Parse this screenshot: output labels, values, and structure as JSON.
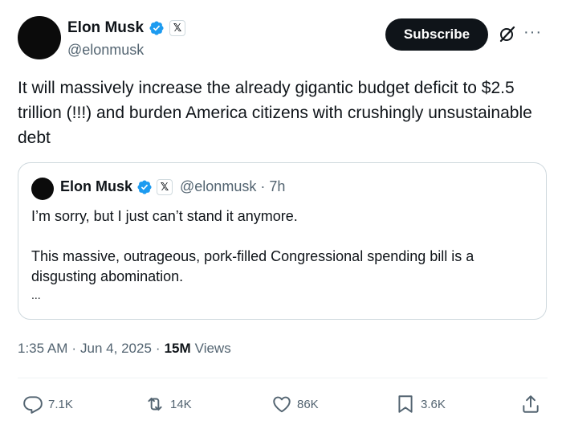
{
  "author": {
    "display_name": "Elon Musk",
    "handle": "@elonmusk",
    "badge_letter": "𝕏"
  },
  "header": {
    "subscribe_label": "Subscribe",
    "more_label": "···"
  },
  "tweet": {
    "text": "It will massively increase the already gigantic budget deficit to $2.5 trillion (!!!) and burden America citizens with crushingly unsustainable debt"
  },
  "quoted": {
    "display_name": "Elon Musk",
    "badge_letter": "𝕏",
    "handle_time": "@elonmusk · 7h",
    "line1": "I’m sorry, but I just can’t stand it anymore.",
    "line2": "This massive, outrageous, pork-filled Congressional spending bill is a disgusting abomination.",
    "ellipsis": "..."
  },
  "meta": {
    "time": "1:35 AM",
    "sep1": "·",
    "date": "Jun 4, 2025",
    "sep2": "·",
    "views_count": "15M",
    "views_label": "Views"
  },
  "actions": {
    "replies": "7.1K",
    "reposts": "14K",
    "likes": "86K",
    "bookmarks": "3.6K"
  },
  "colors": {
    "verified": "#1d9bf0",
    "text": "#0f1419",
    "secondary": "#536471",
    "border": "#cfd9de"
  },
  "icons": [
    "verified-badge-icon",
    "x-logo-icon",
    "grok-icon",
    "more-icon",
    "reply-icon",
    "repost-icon",
    "like-icon",
    "bookmark-icon",
    "share-icon"
  ]
}
